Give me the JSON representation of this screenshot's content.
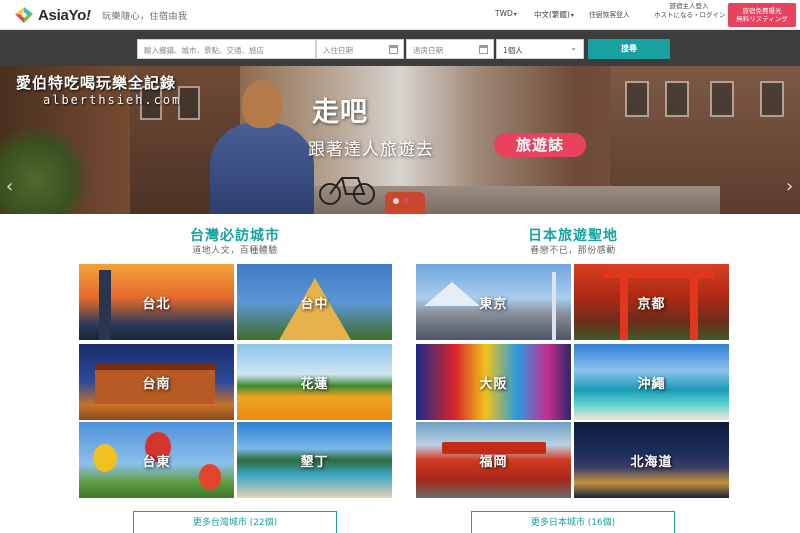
{
  "nav": {
    "logo_text": "AsiaYo",
    "logo_mark": "!",
    "slogan": "玩樂隨心，住宿由我",
    "currency": "TWD",
    "language": "中文(繁體)",
    "host_login": "住宿恢客登入",
    "host_jp_line1": "旅宿主人登入",
    "host_jp_line2": "ホストになる・ログイン",
    "cta_line1": "旅宿免費曝光",
    "cta_line2": "無料リスティング"
  },
  "search": {
    "destination_placeholder": "輸入鄉鎮、城市、景點、交通、旅店",
    "checkin_placeholder": "入住日期",
    "checkout_placeholder": "退房日期",
    "guests_value": "1個人",
    "search_label": "搜尋"
  },
  "hero": {
    "watermark_name": "愛伯特吃喝玩樂全記錄",
    "watermark_url": "alberthsieh.com",
    "title": "走吧",
    "subtitle": "跟著達人旅遊去",
    "badge": "旅遊誌"
  },
  "taiwan": {
    "title": "台灣必訪城市",
    "subtitle": "道地人文，百種體驗",
    "cities": [
      "台北",
      "台中",
      "台南",
      "花蓮",
      "台東",
      "墾丁"
    ],
    "more_label": "更多台灣城市 (22個)"
  },
  "japan": {
    "title": "日本旅遊聖地",
    "subtitle": "眷戀不已，那份感動",
    "cities": [
      "東京",
      "京都",
      "大阪",
      "沖繩",
      "福岡",
      "北海道"
    ],
    "more_label": "更多日本城市 (16個)"
  },
  "colors": {
    "brand_teal": "#17a2a1",
    "brand_pink": "#e8425f",
    "search_bg": "#3d3d3d"
  }
}
